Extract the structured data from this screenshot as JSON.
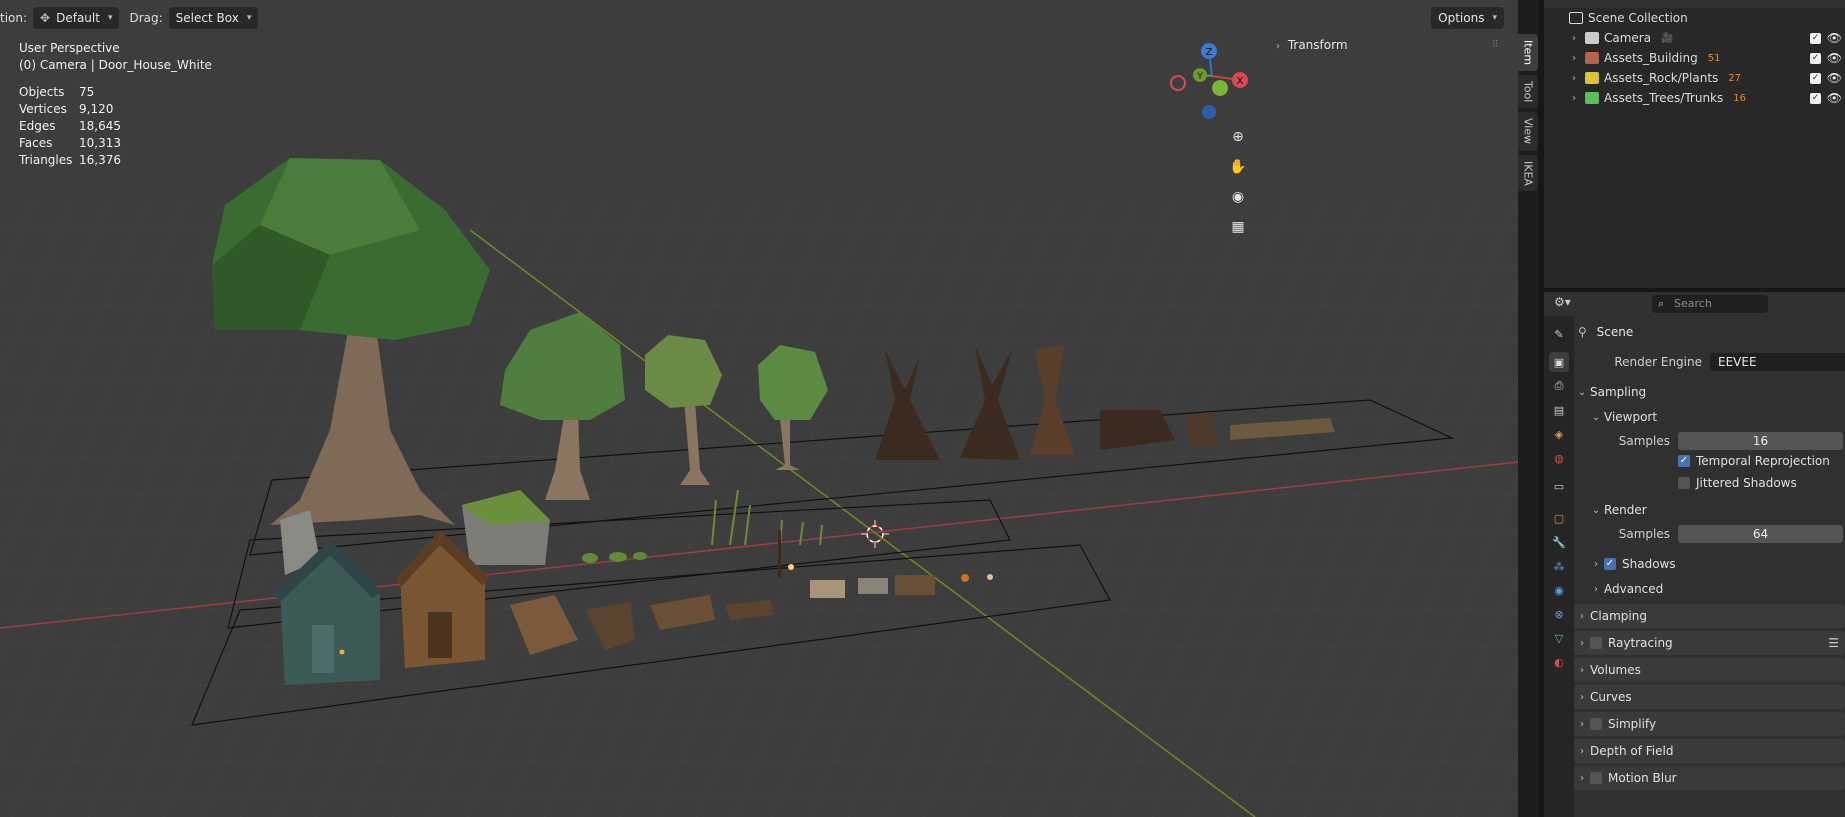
{
  "header": {
    "orientation_label": "tion:",
    "orientation_value": "Default",
    "drag_label": "Drag:",
    "drag_value": "Select Box",
    "options_label": "Options"
  },
  "overlay": {
    "view_name": "User Perspective",
    "active_object": "(0) Camera | Door_House_White",
    "stats": [
      {
        "label": "Objects",
        "value": "75"
      },
      {
        "label": "Vertices",
        "value": "9,120"
      },
      {
        "label": "Edges",
        "value": "18,645"
      },
      {
        "label": "Faces",
        "value": "10,313"
      },
      {
        "label": "Triangles",
        "value": "16,376"
      }
    ]
  },
  "gizmo": {
    "axes": [
      "Z",
      "Y",
      "X"
    ],
    "icons": [
      "zoom-icon",
      "hand-pan-icon",
      "camera-view-icon",
      "grid-ortho-icon"
    ]
  },
  "npanel": {
    "transform_label": "Transform",
    "tabs": [
      "Item",
      "Tool",
      "View",
      "IKEA"
    ],
    "active_tab": "Item"
  },
  "outliner": {
    "root": "Scene Collection",
    "items": [
      {
        "label": "Camera",
        "badge": "",
        "color": "#cccccc"
      },
      {
        "label": "Assets_Building",
        "badge": "51",
        "color": "#b5654a"
      },
      {
        "label": "Assets_Rock/Plants",
        "badge": "27",
        "color": "#d9c33b"
      },
      {
        "label": "Assets_Trees/Trunks",
        "badge": "16",
        "color": "#5bbf5b"
      }
    ]
  },
  "properties": {
    "search_placeholder": "Search",
    "scene_label": "Scene",
    "render_engine_label": "Render Engine",
    "render_engine_value": "EEVEE",
    "sampling_label": "Sampling",
    "viewport_label": "Viewport",
    "viewport_samples_label": "Samples",
    "viewport_samples_value": "16",
    "temporal_reprojection_label": "Temporal Reprojection",
    "jittered_shadows_label": "Jittered Shadows",
    "render_label": "Render",
    "render_samples_label": "Samples",
    "render_samples_value": "64",
    "shadows_label": "Shadows",
    "advanced_label": "Advanced",
    "clamping_label": "Clamping",
    "raytracing_label": "Raytracing",
    "volumes_label": "Volumes",
    "curves_label": "Curves",
    "simplify_label": "Simplify",
    "dof_label": "Depth of Field",
    "motion_blur_label": "Motion Blur",
    "tab_icons": [
      "tool-icon",
      "render-icon",
      "output-icon",
      "view-layer-icon",
      "scene-icon",
      "world-icon",
      "collection-icon",
      "object-icon",
      "modifier-icon",
      "particles-icon",
      "physics-icon",
      "constraints-icon",
      "data-icon",
      "material-icon"
    ]
  }
}
